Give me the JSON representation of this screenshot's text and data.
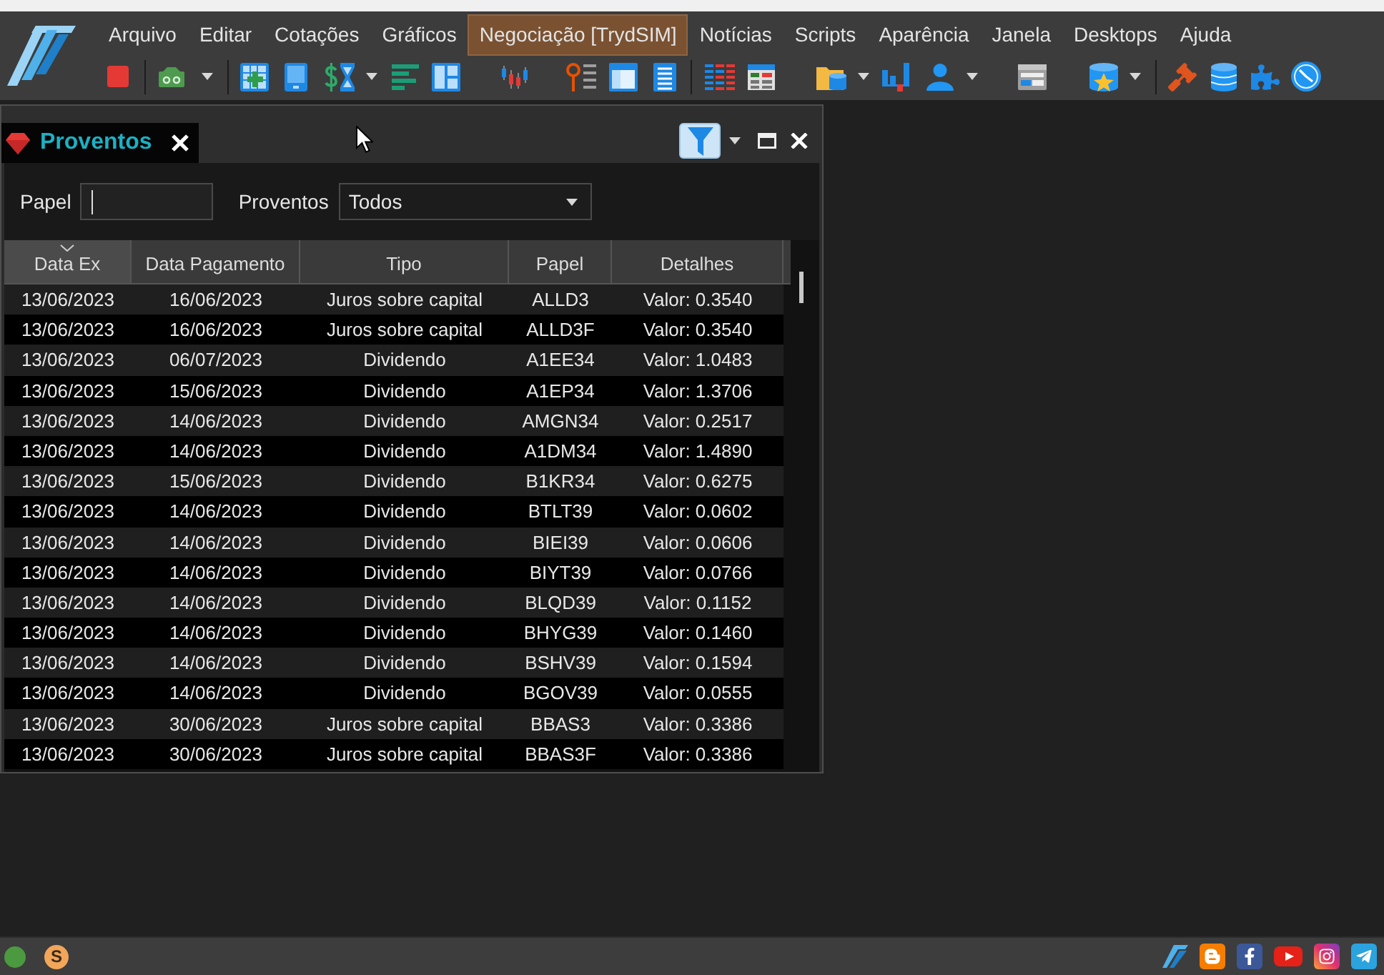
{
  "menu": [
    {
      "label": "Arquivo",
      "highlighted": false
    },
    {
      "label": "Editar",
      "highlighted": false
    },
    {
      "label": "Cotações",
      "highlighted": false
    },
    {
      "label": "Gráficos",
      "highlighted": false
    },
    {
      "label": "Negociação [TrydSIM]",
      "highlighted": true
    },
    {
      "label": "Notícias",
      "highlighted": false
    },
    {
      "label": "Scripts",
      "highlighted": false
    },
    {
      "label": "Aparência",
      "highlighted": false
    },
    {
      "label": "Janela",
      "highlighted": false
    },
    {
      "label": "Desktops",
      "highlighted": false
    },
    {
      "label": "Ajuda",
      "highlighted": false
    }
  ],
  "panel": {
    "title": "Proventos"
  },
  "filters": {
    "papel": {
      "label": "Papel",
      "focused": true
    },
    "proventos": {
      "label": "Proventos",
      "value": "Todos"
    }
  },
  "table": {
    "columns": [
      {
        "label": "Data Ex",
        "sorted": true
      },
      {
        "label": "Data Pagamento",
        "sorted": false
      },
      {
        "label": "Tipo",
        "sorted": false
      },
      {
        "label": "Papel",
        "sorted": false
      },
      {
        "label": "Detalhes",
        "sorted": false
      }
    ],
    "rows": [
      [
        "13/06/2023",
        "16/06/2023",
        "Juros sobre capital",
        "ALLD3",
        "Valor: 0.3540"
      ],
      [
        "13/06/2023",
        "16/06/2023",
        "Juros sobre capital",
        "ALLD3F",
        "Valor: 0.3540"
      ],
      [
        "13/06/2023",
        "06/07/2023",
        "Dividendo",
        "A1EE34",
        "Valor: 1.0483"
      ],
      [
        "13/06/2023",
        "15/06/2023",
        "Dividendo",
        "A1EP34",
        "Valor: 1.3706"
      ],
      [
        "13/06/2023",
        "14/06/2023",
        "Dividendo",
        "AMGN34",
        "Valor: 0.2517"
      ],
      [
        "13/06/2023",
        "14/06/2023",
        "Dividendo",
        "A1DM34",
        "Valor: 1.4890"
      ],
      [
        "13/06/2023",
        "15/06/2023",
        "Dividendo",
        "B1KR34",
        "Valor: 0.6275"
      ],
      [
        "13/06/2023",
        "14/06/2023",
        "Dividendo",
        "BTLT39",
        "Valor: 0.0602"
      ],
      [
        "13/06/2023",
        "14/06/2023",
        "Dividendo",
        "BIEI39",
        "Valor: 0.0606"
      ],
      [
        "13/06/2023",
        "14/06/2023",
        "Dividendo",
        "BIYT39",
        "Valor: 0.0766"
      ],
      [
        "13/06/2023",
        "14/06/2023",
        "Dividendo",
        "BLQD39",
        "Valor: 0.1152"
      ],
      [
        "13/06/2023",
        "14/06/2023",
        "Dividendo",
        "BHYG39",
        "Valor: 0.1460"
      ],
      [
        "13/06/2023",
        "14/06/2023",
        "Dividendo",
        "BSHV39",
        "Valor: 0.1594"
      ],
      [
        "13/06/2023",
        "14/06/2023",
        "Dividendo",
        "BGOV39",
        "Valor: 0.0555"
      ],
      [
        "13/06/2023",
        "30/06/2023",
        "Juros sobre capital",
        "BBAS3",
        "Valor: 0.3386"
      ],
      [
        "13/06/2023",
        "30/06/2023",
        "Juros sobre capital",
        "BBAS3F",
        "Valor: 0.3386"
      ]
    ]
  },
  "status_bar": {
    "coin_label": "S"
  }
}
